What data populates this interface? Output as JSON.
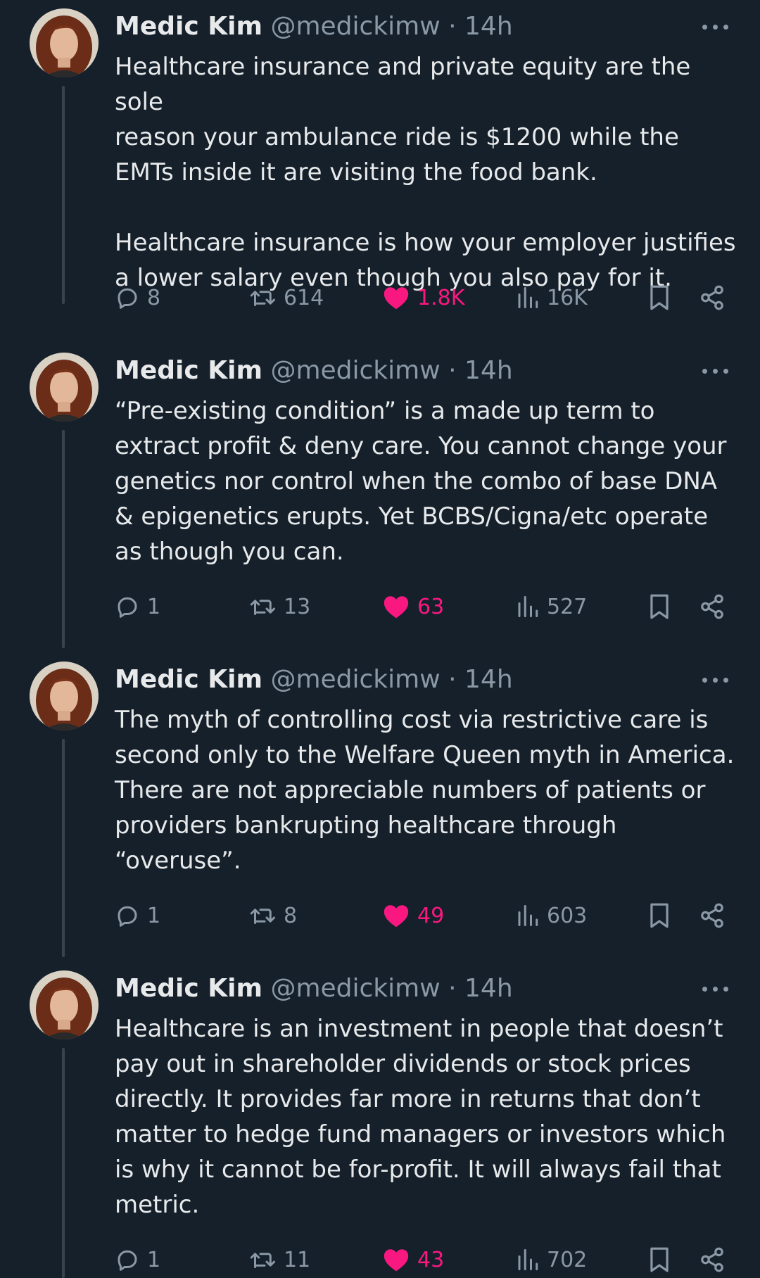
{
  "tweets": [
    {
      "name": "Medic Kim",
      "handle": "@medickimw",
      "dot": "·",
      "time": "14h",
      "text": "Healthcare insurance and private equity are the sole\nreason your ambulance ride is $1200 while the\nEMTs inside it are visiting the food bank.\n\nHealthcare insurance is how your employer justifies\na lower salary even though you also pay for it.",
      "replies": "8",
      "retweets": "614",
      "likes": "1.8K",
      "views": "16K"
    },
    {
      "name": "Medic Kim",
      "handle": "@medickimw",
      "dot": "·",
      "time": "14h",
      "text": "“Pre-existing condition” is a made up term to\nextract profit & deny care. You cannot change your\ngenetics nor control when the combo of base DNA\n& epigenetics erupts. Yet BCBS/Cigna/etc operate\nas though you can.",
      "replies": "1",
      "retweets": "13",
      "likes": "63",
      "views": "527"
    },
    {
      "name": "Medic Kim",
      "handle": "@medickimw",
      "dot": "·",
      "time": "14h",
      "text": "The myth of controlling cost via restrictive care is\nsecond only to the Welfare Queen myth in America.\nThere are not appreciable numbers of patients or\nproviders bankrupting healthcare through\n“overuse”.",
      "replies": "1",
      "retweets": "8",
      "likes": "49",
      "views": "603"
    },
    {
      "name": "Medic Kim",
      "handle": "@medickimw",
      "dot": "·",
      "time": "14h",
      "text": "Healthcare is an investment in people that doesn’t\npay out in shareholder dividends or stock prices\ndirectly. It provides far more in returns that don’t\nmatter to hedge fund managers or investors which\nis why it cannot be for-profit. It will always fail that\nmetric.",
      "replies": "1",
      "retweets": "11",
      "likes": "43",
      "views": "702"
    }
  ],
  "icons": {
    "reply": "reply-icon",
    "retweet": "retweet-icon",
    "like": "heart-icon",
    "views": "views-icon",
    "bookmark": "bookmark-icon",
    "share": "share-icon",
    "more": "more-icon"
  },
  "colors": {
    "background": "#15202b",
    "text": "#e7e9ea",
    "secondary": "#8b98a5",
    "like": "#f91880",
    "thread_line": "#38444d"
  }
}
